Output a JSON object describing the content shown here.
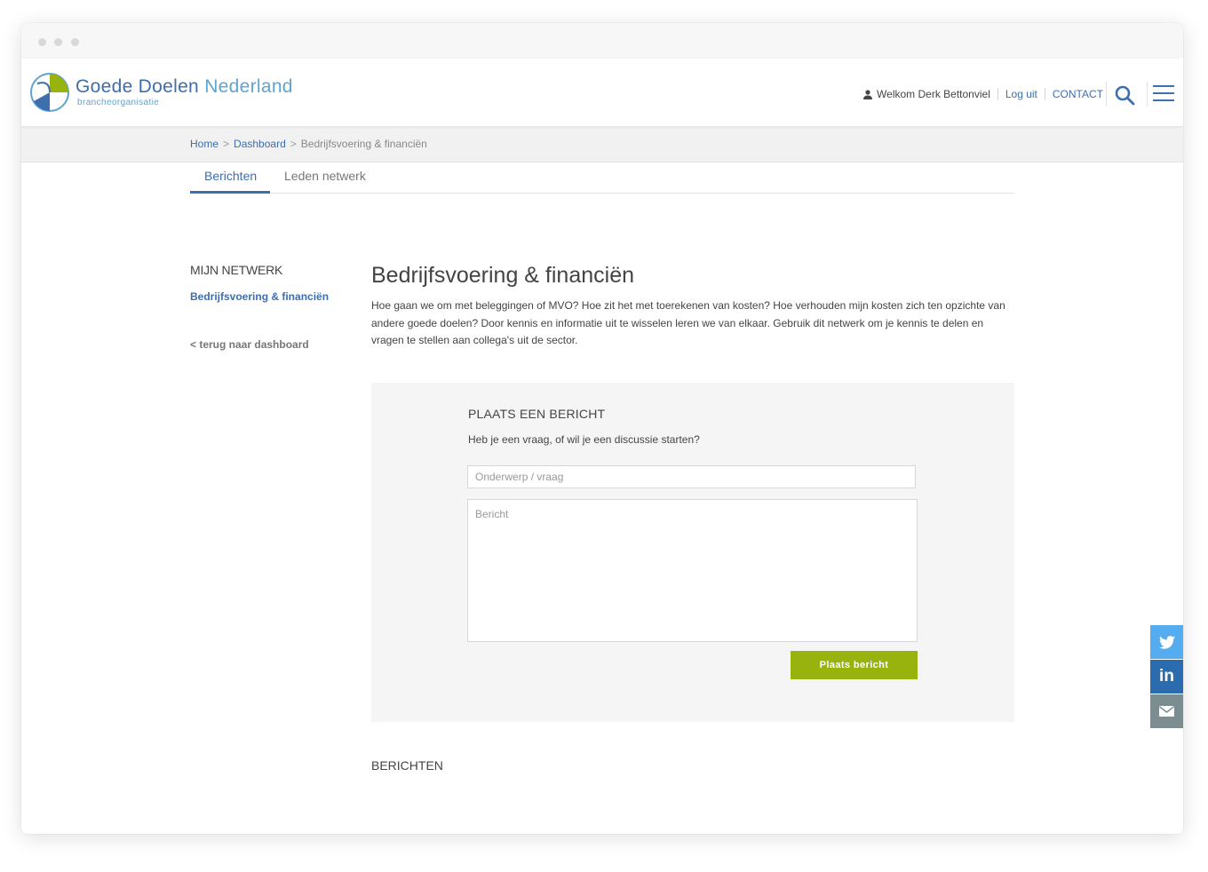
{
  "header": {
    "brand_name": "Goede Doelen",
    "brand_name_light": "Nederland",
    "brand_sub": "brancheorganisatie",
    "welcome": "Welkom Derk Bettonviel",
    "logout": "Log uit",
    "contact": "CONTACT"
  },
  "breadcrumb": {
    "home": "Home",
    "dashboard": "Dashboard",
    "current": "Bedrijfsvoering & financiën",
    "separator": ">"
  },
  "tabs": [
    {
      "label": "Berichten",
      "active": true
    },
    {
      "label": "Leden netwerk",
      "active": false
    }
  ],
  "sidebar": {
    "heading": "MIJN NETWERK",
    "active_item": "Bedrijfsvoering & financiën",
    "back_link": "< terug naar dashboard"
  },
  "main": {
    "title": "Bedrijfsvoering & financiën",
    "intro": "Hoe gaan we om met beleggingen of MVO? Hoe zit het met toerekenen van kosten? Hoe verhouden mijn kosten zich ten opzichte van andere goede doelen? Door kennis en informatie uit te wisselen leren we van elkaar. Gebruik dit netwerk om je kennis te delen en vragen te stellen aan collega's uit de sector."
  },
  "post_form": {
    "title": "PLAATS EEN BERICHT",
    "question": "Heb je een vraag, of wil je een discussie starten?",
    "subject_placeholder": "Onderwerp / vraag",
    "message_placeholder": "Bericht",
    "submit_label": "Plaats bericht"
  },
  "messages": {
    "heading": "BERICHTEN"
  },
  "share": {
    "linkedin_label": "in",
    "icons": [
      "twitter-icon",
      "linkedin-icon",
      "mail-icon"
    ]
  },
  "colors": {
    "brand_blue": "#3d6eae",
    "brand_light_blue": "#5fa4d0",
    "accent_green": "#98b30d",
    "twitter": "#55acee",
    "linkedin": "#2a6cad",
    "mail": "#7c8d92"
  }
}
